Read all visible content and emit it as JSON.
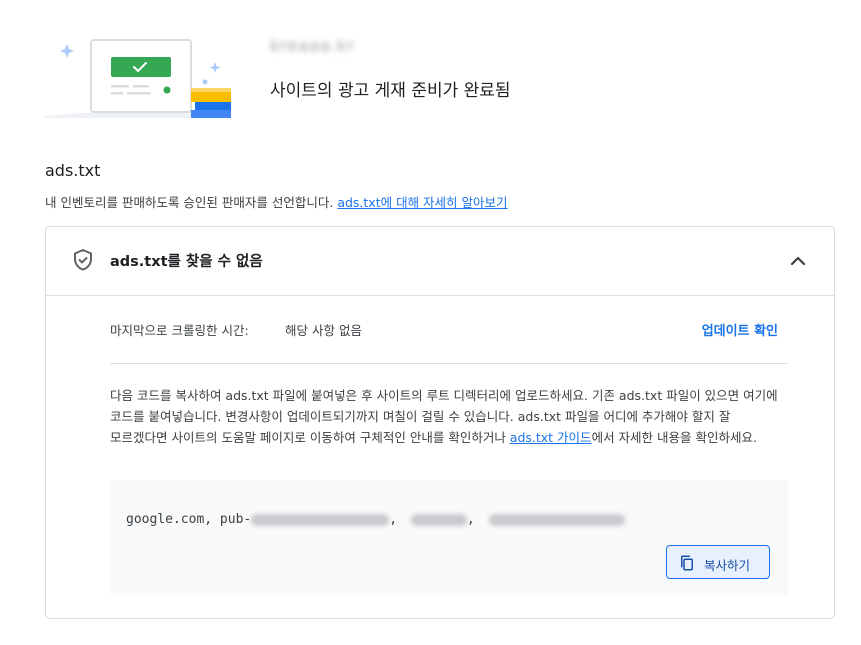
{
  "header": {
    "site_name": "kreaaa.kr",
    "title": "사이트의 광고 게재 준비가 완료됨"
  },
  "section": {
    "title": "ads.txt",
    "description": "내 인벤토리를 판매하도록 승인된 판매자를 선언합니다. ",
    "learn_more_link": "ads.txt에 대해 자세히 알아보기"
  },
  "card": {
    "title": "ads.txt를 찾을 수 없음",
    "last_crawl_label": "마지막으로 크롤링한 시간:",
    "last_crawl_value": "해당 사항 없음",
    "check_update": "업데이트 확인",
    "instructions_before": "다음 코드를 복사하여 ads.txt 파일에 붙여넣은 후 사이트의 루트 디렉터리에 업로드하세요. 기존 ads.txt 파일이 있으면 여기에 코드를 붙여넣습니다. 변경사항이 업데이트되기까지 며칠이 걸릴 수 있습니다. ads.txt 파일을 어디에 추가해야 할지 잘 모르겠다면 사이트의 도움말 페이지로 이동하여 구체적인 안내를 확인하거나 ",
    "guide_link": "ads.txt 가이드",
    "instructions_after": "에서 자세한 내용을 확인하세요.",
    "code_prefix": "google.com, pub-",
    "code_sep1": ",",
    "code_sep2": ",",
    "copy_button": "복사하기"
  },
  "colors": {
    "accent": "#1a73e8",
    "success_green": "#34a853",
    "border": "#dadce0"
  },
  "icons": {
    "shield": "shield-check-icon",
    "chevron": "chevron-up-icon",
    "copy": "copy-icon"
  }
}
